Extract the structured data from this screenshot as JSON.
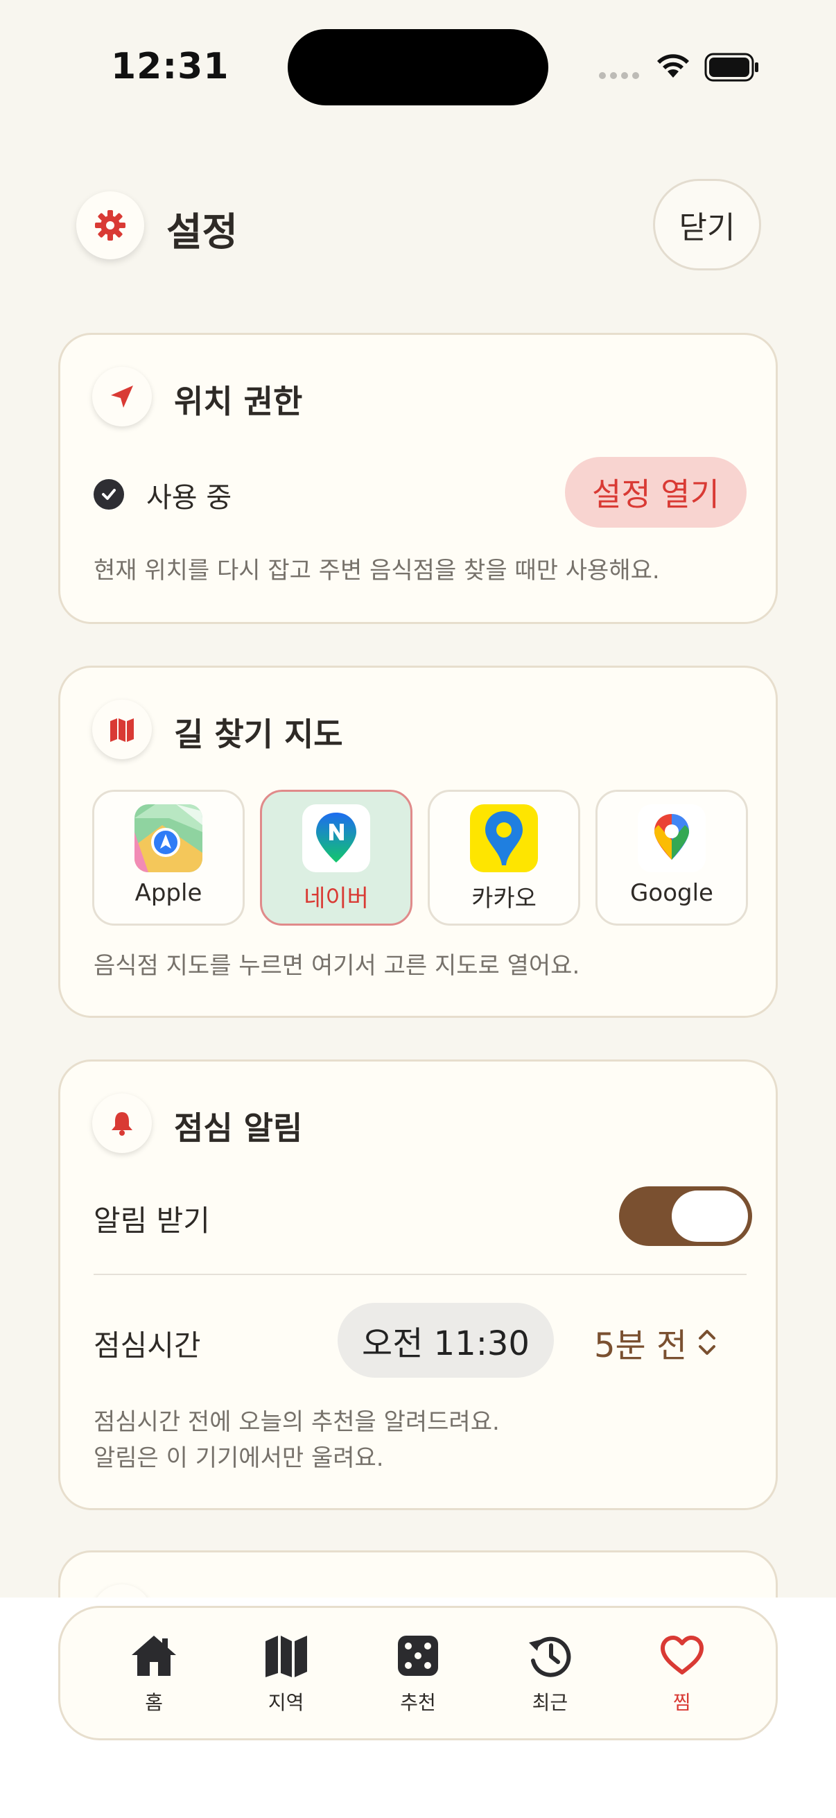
{
  "status_bar": {
    "time": "12:31"
  },
  "header": {
    "title": "설정",
    "close_label": "닫기"
  },
  "location": {
    "title": "위치 권한",
    "status": "사용 중",
    "open_settings_label": "설정 열기",
    "caption": "현재 위치를 다시 잡고 주변 음식점을 찾을 때만 사용해요."
  },
  "maps": {
    "title": "길 찾기 지도",
    "options": [
      {
        "label": "Apple",
        "selected": false
      },
      {
        "label": "네이버",
        "selected": true
      },
      {
        "label": "카카오",
        "selected": false
      },
      {
        "label": "Google",
        "selected": false
      }
    ],
    "caption": "음식점 지도를 누르면 여기서 고른 지도로 열어요."
  },
  "alarm": {
    "title": "점심 알림",
    "receive_label": "알림 받기",
    "receive_on": true,
    "lunch_time_label": "점심시간",
    "time_value": "오전 11:30",
    "offset_value": "5분 전",
    "caption_line1": "점심시간 전에 오늘의 추천을 알려드려요.",
    "caption_line2": "알림은 이 기기에서만 울려요."
  },
  "tabs": [
    {
      "label": "홈",
      "icon": "home-icon"
    },
    {
      "label": "지역",
      "icon": "map-icon"
    },
    {
      "label": "추천",
      "icon": "dice-icon"
    },
    {
      "label": "최근",
      "icon": "history-icon"
    },
    {
      "label": "찜",
      "icon": "heart-icon",
      "active": true
    }
  ],
  "colors": {
    "accent": "#d93a34",
    "brown": "#7a5030",
    "background": "#f8f6ef",
    "card": "#fffdf6"
  }
}
